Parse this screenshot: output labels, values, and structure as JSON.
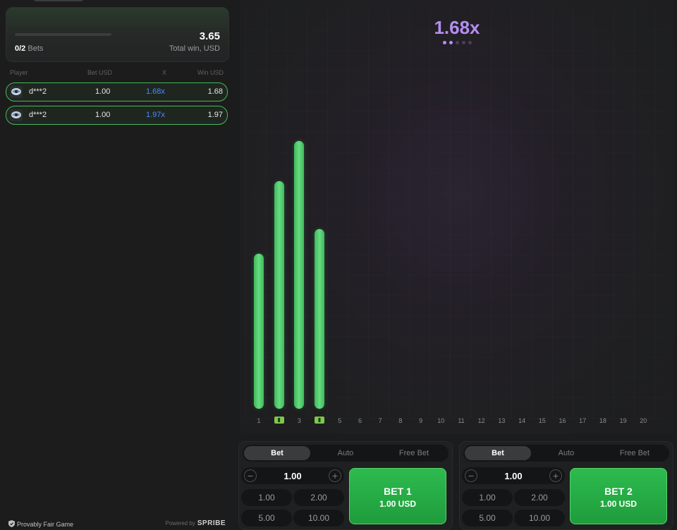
{
  "summary": {
    "bets_count": "0/2",
    "bets_label": "Bets",
    "total_win": "3.65",
    "total_win_label": "Total win, USD"
  },
  "bets_table": {
    "headers": {
      "player": "Player",
      "bet": "Bet USD",
      "x": "X",
      "win": "Win USD"
    },
    "rows": [
      {
        "player": "d***2",
        "bet": "1.00",
        "multiplier": "1.68x",
        "win": "1.68"
      },
      {
        "player": "d***2",
        "bet": "1.00",
        "multiplier": "1.97x",
        "win": "1.97"
      }
    ]
  },
  "footer": {
    "provably_fair": "Provably Fair Game",
    "powered_by": "Powered by",
    "brand": "SPRIBE"
  },
  "game": {
    "multiplier": "1.68x",
    "dots_total": 5,
    "dots_active": 2,
    "columns": [
      "1",
      "2",
      "3",
      "4",
      "5",
      "6",
      "7",
      "8",
      "9",
      "10",
      "11",
      "12",
      "13",
      "14",
      "15",
      "16",
      "17",
      "18",
      "19",
      "20"
    ],
    "bar_levels": [
      0.58,
      0.85,
      1.0,
      0.67
    ],
    "marked_columns": [
      2,
      4
    ],
    "colors": {
      "bar": "#4fcf6a",
      "multiplier": "#b48ef2",
      "row_border": "#47b85a",
      "row_multiplier": "#4a8cff"
    }
  },
  "bet_panels": [
    {
      "tabs": [
        "Bet",
        "Auto",
        "Free Bet"
      ],
      "active_tab": "Bet",
      "amount": "1.00",
      "chips": [
        "1.00",
        "2.00",
        "5.00",
        "10.00"
      ],
      "button_title": "BET 1",
      "button_amount": "1.00 USD"
    },
    {
      "tabs": [
        "Bet",
        "Auto",
        "Free Bet"
      ],
      "active_tab": "Bet",
      "amount": "1.00",
      "chips": [
        "1.00",
        "2.00",
        "5.00",
        "10.00"
      ],
      "button_title": "BET 2",
      "button_amount": "1.00 USD"
    }
  ]
}
